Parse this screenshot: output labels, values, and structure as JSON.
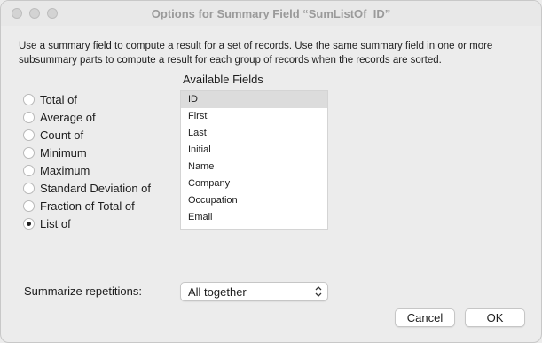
{
  "window": {
    "title": "Options for Summary Field “SumListOf_ID”"
  },
  "description": "Use a summary field to compute a result for a set of records. Use the same summary field in one or more subsummary parts to compute a result for each group of records when the records are sorted.",
  "summary_types": [
    {
      "label": "Total of",
      "selected": false
    },
    {
      "label": "Average of",
      "selected": false
    },
    {
      "label": "Count of",
      "selected": false
    },
    {
      "label": "Minimum",
      "selected": false
    },
    {
      "label": "Maximum",
      "selected": false
    },
    {
      "label": "Standard Deviation of",
      "selected": false
    },
    {
      "label": "Fraction of Total of",
      "selected": false
    },
    {
      "label": "List of",
      "selected": true
    }
  ],
  "available_fields": {
    "label": "Available Fields",
    "items": [
      "ID",
      "First",
      "Last",
      "Initial",
      "Name",
      "Company",
      "Occupation",
      "Email"
    ],
    "selected": "ID"
  },
  "repetitions": {
    "label": "Summarize repetitions:",
    "value": "All together"
  },
  "buttons": {
    "cancel": "Cancel",
    "ok": "OK"
  }
}
